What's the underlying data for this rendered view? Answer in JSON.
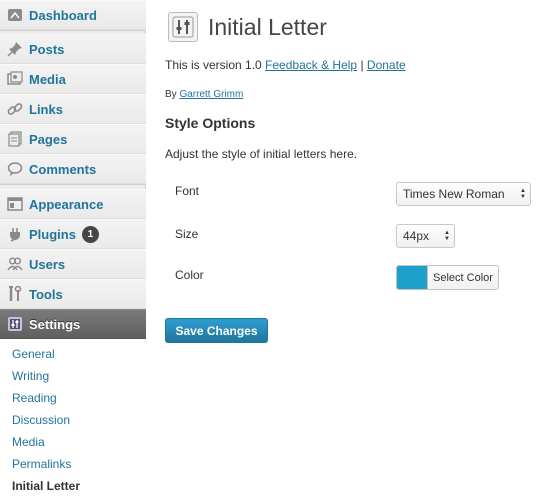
{
  "sidebar": {
    "items": [
      {
        "label": "Dashboard",
        "icon": "dashboard-icon"
      },
      {
        "label": "Posts",
        "icon": "pin-icon"
      },
      {
        "label": "Media",
        "icon": "media-icon"
      },
      {
        "label": "Links",
        "icon": "link-icon"
      },
      {
        "label": "Pages",
        "icon": "pages-icon"
      },
      {
        "label": "Comments",
        "icon": "comment-icon"
      },
      {
        "label": "Appearance",
        "icon": "appearance-icon"
      },
      {
        "label": "Plugins",
        "icon": "plug-icon",
        "badge": "1"
      },
      {
        "label": "Users",
        "icon": "users-icon"
      },
      {
        "label": "Tools",
        "icon": "tools-icon"
      },
      {
        "label": "Settings",
        "icon": "settings-icon"
      }
    ],
    "submenu": [
      {
        "label": "General"
      },
      {
        "label": "Writing"
      },
      {
        "label": "Reading"
      },
      {
        "label": "Discussion"
      },
      {
        "label": "Media"
      },
      {
        "label": "Permalinks"
      },
      {
        "label": "Initial Letter"
      }
    ]
  },
  "main": {
    "title": "Initial Letter",
    "version_text": "This is version 1.0",
    "feedback_link": "Feedback & Help",
    "separator": "|",
    "donate_link": "Donate",
    "by_text": "By",
    "author_link": "Garrett Grimm",
    "section_title": "Style Options",
    "section_desc": "Adjust the style of initial letters here.",
    "font_label": "Font",
    "font_value": "Times New Roman",
    "size_label": "Size",
    "size_value": "44px",
    "color_label": "Color",
    "color_value": "#1ea0cc",
    "select_color_label": "Select Color",
    "save_label": "Save Changes"
  }
}
